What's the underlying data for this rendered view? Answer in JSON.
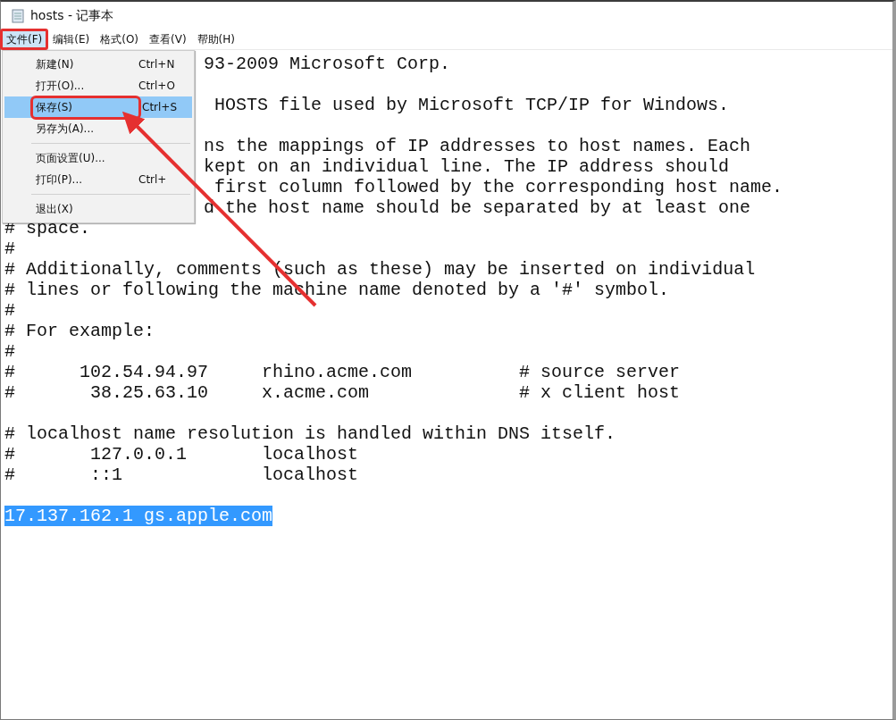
{
  "window": {
    "title": "hosts - 记事本"
  },
  "menubar": [
    {
      "label": "文件(F)",
      "selected": true,
      "annotated": true
    },
    {
      "label": "编辑(E)",
      "selected": false,
      "annotated": false
    },
    {
      "label": "格式(O)",
      "selected": false,
      "annotated": false
    },
    {
      "label": "查看(V)",
      "selected": false,
      "annotated": false
    },
    {
      "label": "帮助(H)",
      "selected": false,
      "annotated": false
    }
  ],
  "file_menu": [
    {
      "kind": "item",
      "label": "新建(N)",
      "shortcut": "Ctrl+N",
      "selected": false,
      "annotated": false
    },
    {
      "kind": "item",
      "label": "打开(O)...",
      "shortcut": "Ctrl+O",
      "selected": false,
      "annotated": false
    },
    {
      "kind": "item",
      "label": "保存(S)",
      "shortcut": "Ctrl+S",
      "selected": true,
      "annotated": true
    },
    {
      "kind": "item",
      "label": "另存为(A)...",
      "selected": false,
      "annotated": false
    },
    {
      "kind": "separator"
    },
    {
      "kind": "item",
      "label": "页面设置(U)...",
      "selected": false,
      "annotated": false
    },
    {
      "kind": "item",
      "label": "打印(P)...",
      "shortcut": "Ctrl+",
      "selected": false,
      "annotated": false
    },
    {
      "kind": "separator"
    },
    {
      "kind": "item",
      "label": "退出(X)",
      "selected": false,
      "annotated": false
    }
  ],
  "editor_lines": [
    {
      "kind": "covered",
      "text": "93-2009 Microsoft Corp."
    },
    {
      "kind": "blank"
    },
    {
      "kind": "covered",
      "text": " HOSTS file used by Microsoft TCP/IP for Windows."
    },
    {
      "kind": "blank"
    },
    {
      "kind": "covered",
      "text": "ns the mappings of IP addresses to host names. Each"
    },
    {
      "kind": "covered",
      "text": "kept on an individual line. The IP address should"
    },
    {
      "kind": "covered",
      "text": " first column followed by the corresponding host name."
    },
    {
      "kind": "covered",
      "text": "d the host name should be separated by at least one"
    },
    {
      "kind": "text",
      "text": "# space."
    },
    {
      "kind": "text",
      "text": "#"
    },
    {
      "kind": "text",
      "text": "# Additionally, comments (such as these) may be inserted on individual"
    },
    {
      "kind": "text",
      "text": "# lines or following the machine name denoted by a '#' symbol."
    },
    {
      "kind": "text",
      "text": "#"
    },
    {
      "kind": "text",
      "text": "# For example:"
    },
    {
      "kind": "text",
      "text": "#"
    },
    {
      "kind": "text",
      "text": "#      102.54.94.97     rhino.acme.com          # source server"
    },
    {
      "kind": "text",
      "text": "#       38.25.63.10     x.acme.com              # x client host"
    },
    {
      "kind": "blank"
    },
    {
      "kind": "text",
      "text": "# localhost name resolution is handled within DNS itself."
    },
    {
      "kind": "text",
      "text": "#       127.0.0.1       localhost"
    },
    {
      "kind": "text",
      "text": "#       ::1             localhost"
    },
    {
      "kind": "blank"
    },
    {
      "kind": "selected",
      "text": "17.137.162.1 gs.apple.com"
    }
  ]
}
